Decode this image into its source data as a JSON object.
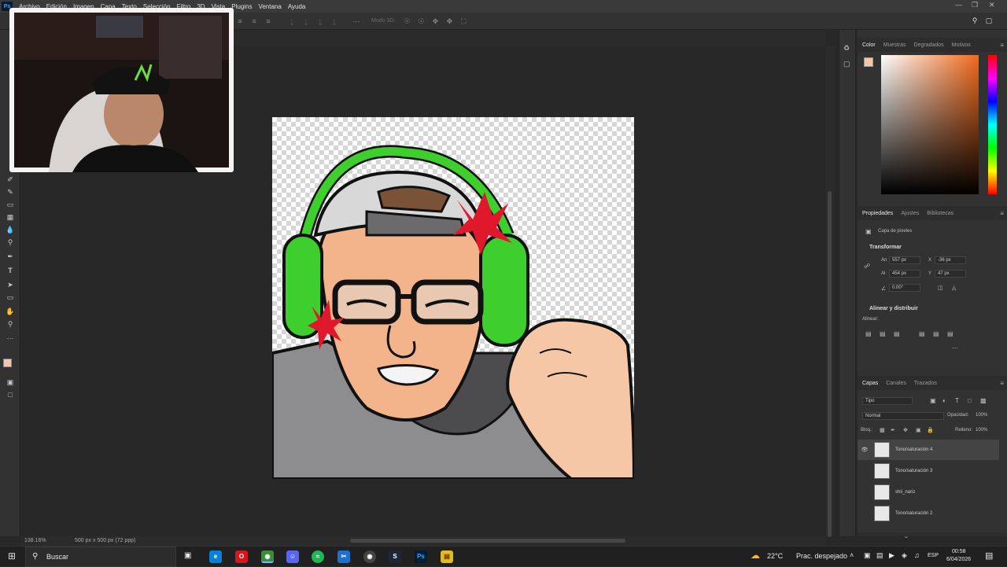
{
  "menubar": {
    "app_logo": "Ps",
    "items": [
      "Archivo",
      "Edición",
      "Imagen",
      "Capa",
      "Texto",
      "Selección",
      "Filtro",
      "3D",
      "Vista",
      "Plugins",
      "Ventana",
      "Ayuda"
    ]
  },
  "optionsbar": {
    "mode_label": "Modo 3D:"
  },
  "document": {
    "zoom": "138.16%",
    "doc_info": "500 px x 500 px (72 ppp)"
  },
  "color_panel": {
    "tabs": [
      "Color",
      "Muestras",
      "Degradados",
      "Motivos"
    ],
    "foreground_color": "#f6c7a6",
    "background_color": "#ffffff"
  },
  "properties_panel": {
    "tabs": [
      "Propiedades",
      "Ajustes",
      "Bibliotecas"
    ],
    "layer_kind": "Capa de píxeles",
    "transform": {
      "title": "Transformar",
      "w_label": "An",
      "w_value": "557 px",
      "h_label": "Al",
      "h_value": "454 px",
      "x_label": "X",
      "x_value": "-36 px",
      "y_label": "Y",
      "y_value": "47 px",
      "angle_value": "0.00°"
    },
    "align": {
      "title": "Alinear y distribuir",
      "label": "Alinear:"
    }
  },
  "layers_panel": {
    "tabs": [
      "Capas",
      "Canales",
      "Trazados"
    ],
    "filter_label": "Tipo",
    "blend_mode": "Normal",
    "opacity_label": "Opacidad:",
    "opacity_value": "100%",
    "lock_label": "Bloq.:",
    "fill_label": "Relleno:",
    "fill_value": "100%",
    "layers": [
      {
        "name": "Tono/saturación 4",
        "visible": true,
        "selected": true
      },
      {
        "name": "Tono/saturación 3",
        "visible": false,
        "selected": false
      },
      {
        "name": "shii_nariz",
        "visible": false,
        "selected": false
      },
      {
        "name": "Tono/saturación 2",
        "visible": false,
        "selected": false
      }
    ]
  },
  "taskbar": {
    "search_label": "Buscar",
    "weather_temp": "22°C",
    "weather_desc": "Prac. despejado",
    "language": "ESP",
    "time": "00:58",
    "date": "6/04/2026"
  }
}
